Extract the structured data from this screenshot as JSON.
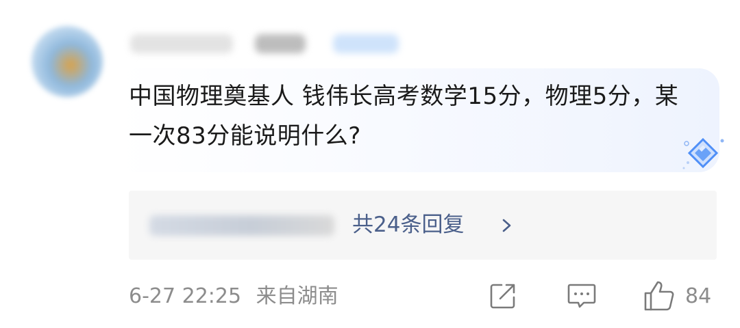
{
  "comment": {
    "text": "中国物理奠基人 钱伟长高考数学15分，物理5分，某一次83分能说明什么?",
    "reply_summary": "共24条回复",
    "timestamp": "6-27 22:25",
    "location": "来自湖南",
    "like_count": "84"
  },
  "icons": {
    "reply_chevron": "chevron-right-icon",
    "badge": "diamond-badge-icon",
    "share": "share-icon",
    "reply": "comment-icon",
    "like": "thumbs-up-icon"
  },
  "colors": {
    "text": "#1a1a1a",
    "link": "#4a5f8a",
    "meta": "#8c8c8c",
    "reply_bg": "#f6f6f6",
    "badge_blue": "#4f8ff7"
  }
}
